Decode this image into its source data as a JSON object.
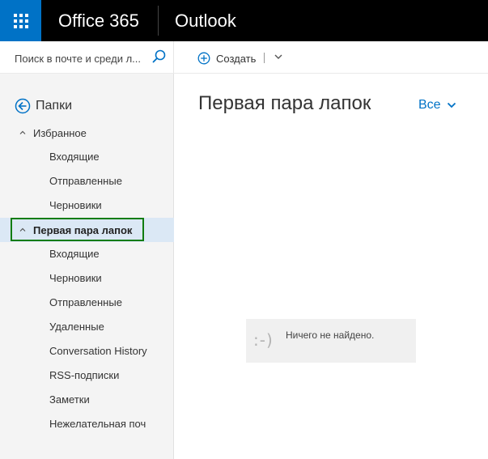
{
  "topbar": {
    "brand": "Office 365",
    "app_name": "Outlook",
    "waffle_icon": "app-launcher-icon",
    "accent": "#0072c6"
  },
  "search": {
    "placeholder": "Поиск в почте и среди л...",
    "icon": "search-icon"
  },
  "commands": {
    "new_label": "Создать",
    "new_icon": "plus-circle-icon",
    "menu_icon": "chevron-down-icon"
  },
  "nav": {
    "folders_label": "Папки",
    "favorites": {
      "label": "Избранное",
      "items": [
        "Входящие",
        "Отправленные",
        "Черновики"
      ]
    },
    "account": {
      "label": "Первая пара лапок",
      "selected": true,
      "items": [
        "Входящие",
        "Черновики",
        "Отправленные",
        "Удаленные",
        "Conversation History",
        "RSS-подписки",
        "Заметки",
        "Нежелательная поч"
      ]
    }
  },
  "main": {
    "folder_title": "Первая пара лапок",
    "filter_label": "Все",
    "empty_face": ":-)",
    "empty_message": "Ничего не найдено."
  },
  "colors": {
    "selection_bg": "#dbe8f5",
    "selection_outline": "#107c10",
    "link": "#0072c6"
  }
}
